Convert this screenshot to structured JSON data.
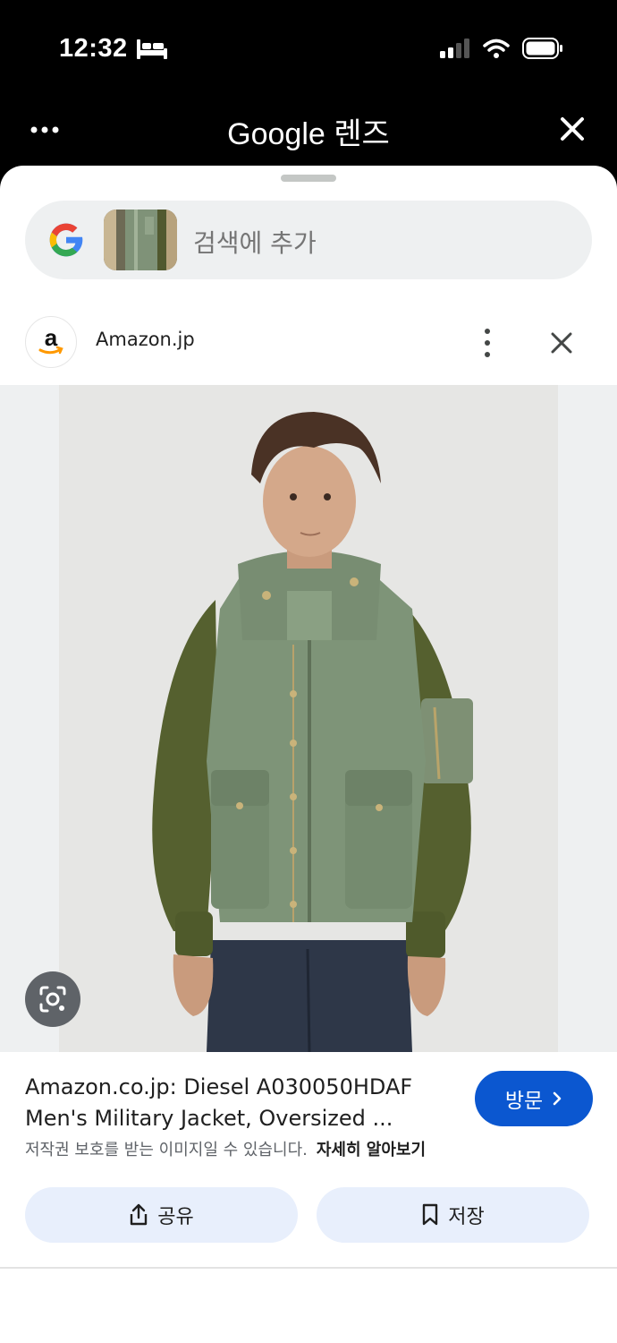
{
  "status_bar": {
    "time": "12:32"
  },
  "header": {
    "title": "Google 렌즈"
  },
  "search": {
    "placeholder": "검색에 추가"
  },
  "source": {
    "name": "Amazon.jp"
  },
  "result": {
    "title_line1": "Amazon.co.jp: Diesel A030050HDAF",
    "title_line2": "Men's Military Jacket, Oversized ...",
    "visit_label": "방문",
    "copyright_notice": "저작권 보호를 받는 이미지일 수 있습니다.",
    "learn_more": "자세히 알아보기"
  },
  "actions": {
    "share_label": "공유",
    "save_label": "저장"
  },
  "colors": {
    "accent": "#0b57d0",
    "action_bg": "#e8effc",
    "search_bg": "#eef0f1",
    "jacket_body": "#7e9478",
    "jacket_sleeves": "#4f5a2e"
  },
  "icons": [
    "bed-icon",
    "signal-icon",
    "wifi-icon",
    "battery-icon",
    "more-horizontal-icon",
    "close-icon",
    "google-g-icon",
    "amazon-icon",
    "more-vertical-icon",
    "lens-camera-icon",
    "chevron-right-icon",
    "share-icon",
    "bookmark-icon"
  ]
}
